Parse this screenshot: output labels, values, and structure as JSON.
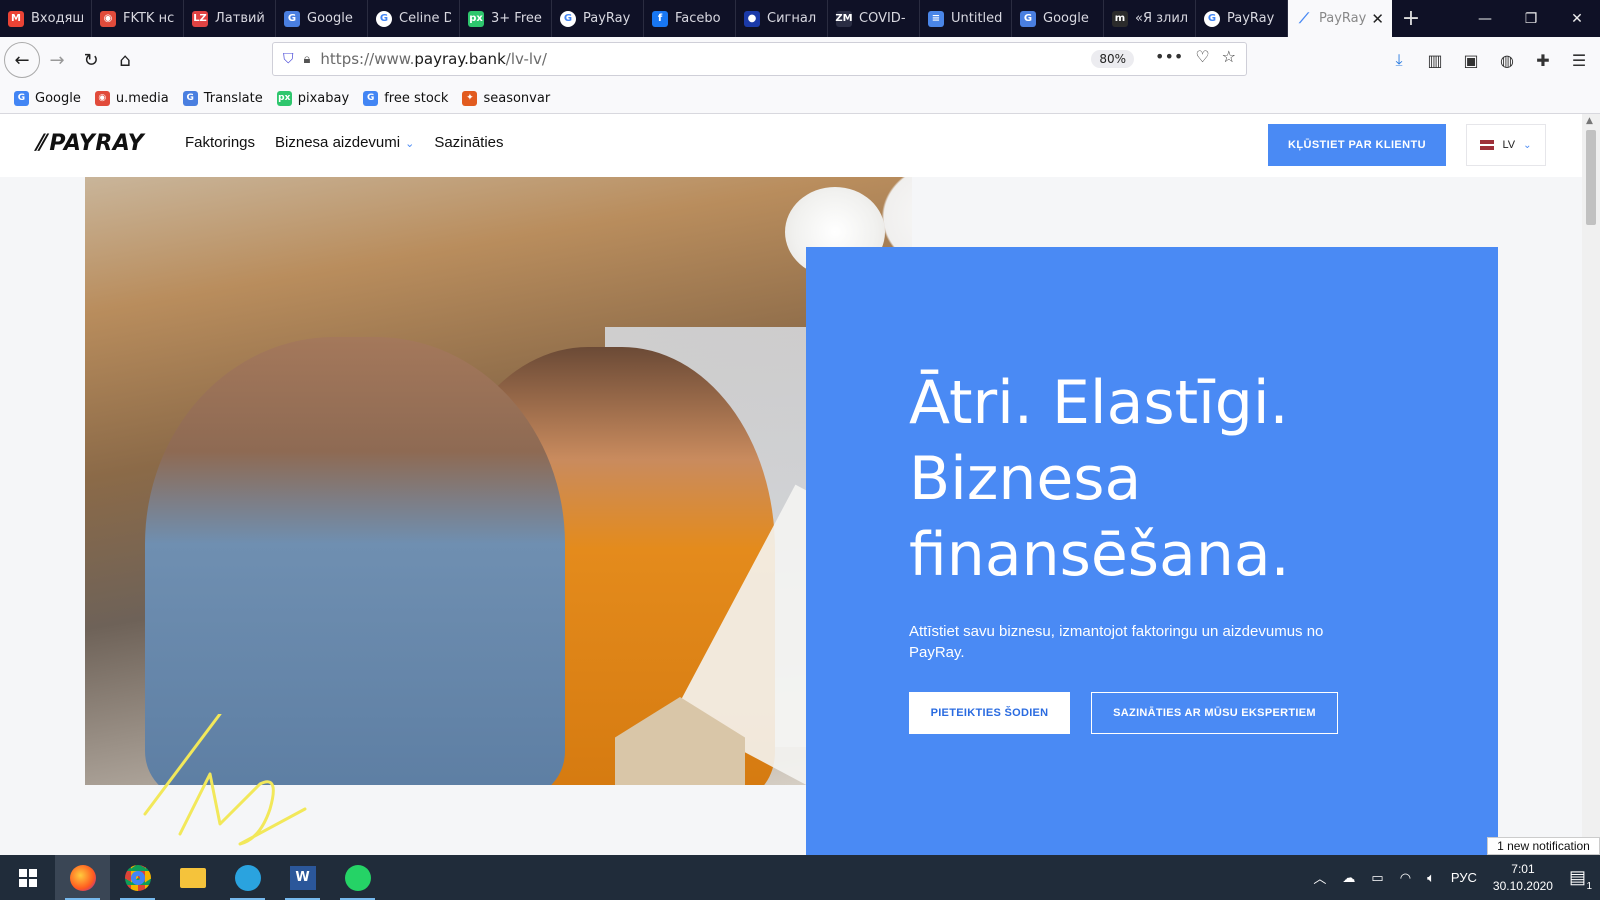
{
  "browser": {
    "tabs": [
      {
        "label": "Входящ",
        "icon": "gmail-icon",
        "color": "#ea4335",
        "glyph": "M"
      },
      {
        "label": "FKTK нс",
        "icon": "umedia-icon",
        "color": "#e14b3b",
        "glyph": "◉"
      },
      {
        "label": "Латвий",
        "icon": "lz-icon",
        "color": "#e04343",
        "glyph": "LZ"
      },
      {
        "label": "Google",
        "icon": "translate-icon",
        "color": "#4a7fe0",
        "glyph": "G"
      },
      {
        "label": "Celine D",
        "icon": "google-icon",
        "color": "#ffffff",
        "glyph": "G"
      },
      {
        "label": "3+ Free",
        "icon": "pixabay-icon",
        "color": "#2ec66d",
        "glyph": "px"
      },
      {
        "label": "PayRay",
        "icon": "google-icon",
        "color": "#ffffff",
        "glyph": "G"
      },
      {
        "label": "Facebo",
        "icon": "facebook-icon",
        "color": "#1877f2",
        "glyph": "f"
      },
      {
        "label": "Сигнал",
        "icon": "signal-icon",
        "color": "#1b3aa8",
        "glyph": "●"
      },
      {
        "label": "COVID-",
        "icon": "zm-icon",
        "color": "#2b2e44",
        "glyph": "ZM"
      },
      {
        "label": "Untitled",
        "icon": "docs-icon",
        "color": "#4a86e8",
        "glyph": "≡"
      },
      {
        "label": "Google",
        "icon": "translate-icon",
        "color": "#4a7fe0",
        "glyph": "G"
      },
      {
        "label": "«Я злил",
        "icon": "m-icon",
        "color": "#2b2b2b",
        "glyph": "m"
      },
      {
        "label": "PayRay",
        "icon": "google-icon",
        "color": "#ffffff",
        "glyph": "G"
      }
    ],
    "active_tab": {
      "label": "PayRay",
      "icon": "payray-icon"
    },
    "url_prefix": "https://www.",
    "url_host": "payray.bank",
    "url_path": "/lv-lv/",
    "zoom": "80%",
    "bookmarks": [
      {
        "label": "Google",
        "color": "#4285f4",
        "glyph": "G"
      },
      {
        "label": "u.media",
        "color": "#e14b3b",
        "glyph": "◉"
      },
      {
        "label": "Translate",
        "color": "#4a7fe0",
        "glyph": "G"
      },
      {
        "label": "pixabay",
        "color": "#2ec66d",
        "glyph": "px"
      },
      {
        "label": "free stock",
        "color": "#4285f4",
        "glyph": "G"
      },
      {
        "label": "seasonvar",
        "color": "#e25b1f",
        "glyph": "✦"
      }
    ]
  },
  "site": {
    "logo": "PAYRAY",
    "nav": [
      "Faktorings",
      "Biznesa aizdevumi",
      "Sazināties"
    ],
    "cta": "KĻŪSTIET PAR KLIENTU",
    "lang": "LV",
    "accent": "#4a8af4",
    "hero": {
      "line1": "Ātri. Elastīgi.",
      "line2": "Biznesa",
      "line3": "finansēšana.",
      "sub": "Attīstiet savu biznesu, izmantojot faktoringu un aizdevumus no PayRay.",
      "btn_primary": "PIETEIKTIES ŠODIEN",
      "btn_secondary": "SAZINĀTIES AR MŪSU EKSPERTIEM"
    }
  },
  "os": {
    "notification": "1 new notification",
    "lang": "РУС",
    "time": "7:01",
    "date": "30.10.2020",
    "notif_count": "1"
  }
}
